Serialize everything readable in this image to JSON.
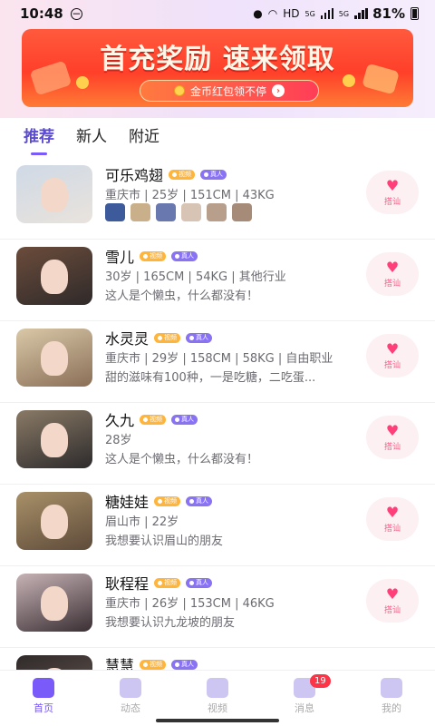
{
  "status_bar": {
    "time": "10:48",
    "battery": "81%",
    "network": "HD",
    "signal_a": "5G",
    "signal_b": "5G"
  },
  "banner": {
    "title": "首充奖励 速来领取",
    "pill": "金币红包领不停"
  },
  "tabs": [
    {
      "label": "推荐"
    },
    {
      "label": "新人"
    },
    {
      "label": "附近"
    }
  ],
  "badges": {
    "video": "视频",
    "real": "真人"
  },
  "greet_label": "搭讪",
  "users": [
    {
      "name": "可乐鸡翅",
      "info": "重庆市 | 25岁 | 151CM | 43KG",
      "bio": ""
    },
    {
      "name": "雪儿",
      "info": "30岁 | 165CM | 54KG | 其他行业",
      "bio": "这人是个懒虫，什么都没有！"
    },
    {
      "name": "水灵灵",
      "info": "重庆市 | 29岁 | 158CM | 58KG | 自由职业",
      "bio": "甜的滋味有100种，一是吃糖，二吃蛋..."
    },
    {
      "name": "久九",
      "info": "28岁",
      "bio": "这人是个懒虫，什么都没有！"
    },
    {
      "name": "糖娃娃",
      "info": "眉山市 | 22岁",
      "bio": "我想要认识眉山的朋友"
    },
    {
      "name": "耿程程",
      "info": "重庆市 | 26岁 | 153CM | 46KG",
      "bio": "我想要认识九龙坡的朋友"
    },
    {
      "name": "慧慧",
      "info": "",
      "bio": ""
    }
  ],
  "bottom_nav": [
    {
      "label": "首页",
      "icon": "home-icon"
    },
    {
      "label": "动态",
      "icon": "star-icon"
    },
    {
      "label": "视频",
      "icon": "video-icon"
    },
    {
      "label": "消息",
      "icon": "bell-icon",
      "badge": "19"
    },
    {
      "label": "我的",
      "icon": "profile-icon"
    }
  ]
}
